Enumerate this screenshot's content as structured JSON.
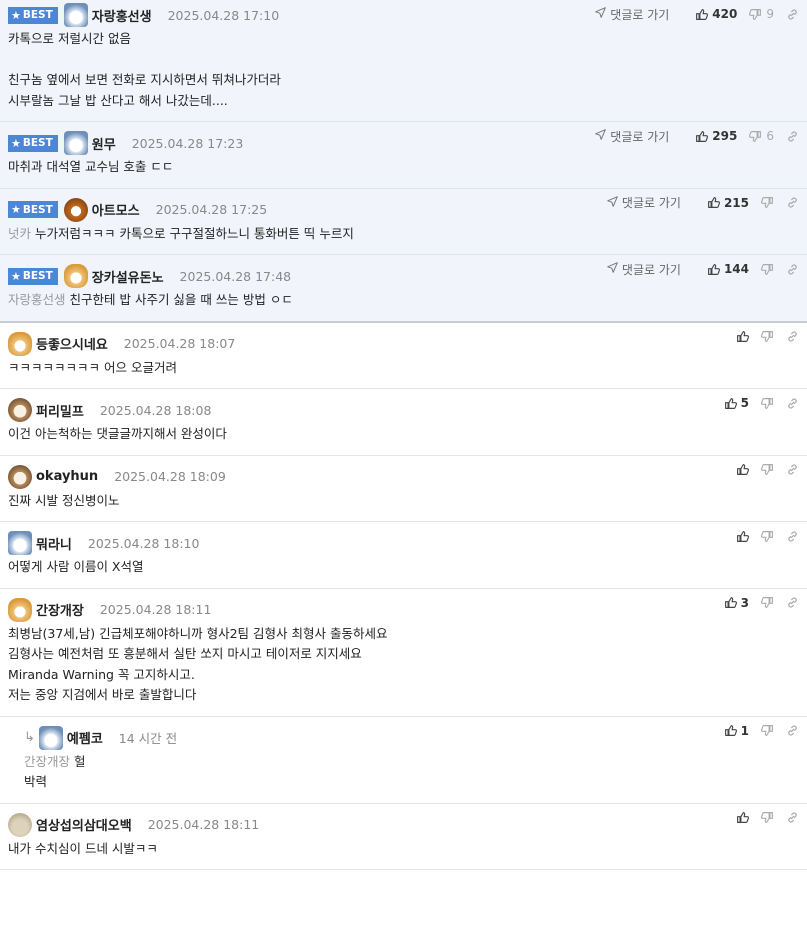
{
  "best_label": "BEST",
  "goto_label": "댓글로 가기",
  "comments": [
    {
      "best": true,
      "avatar": "av-blue",
      "nick": "자랑홍선생",
      "date": "2025.04.28 17:10",
      "up": "420",
      "down": "9",
      "goto": true,
      "lines": [
        "카톡으로 저럴시간 없음",
        "",
        "친구놈 옆에서 보면 전화로 지시하면서 뛰쳐나가더라",
        "시부랄놈 그날 밥 산다고 해서 나갔는데...."
      ]
    },
    {
      "best": true,
      "avatar": "av-blue",
      "nick": "원무",
      "date": "2025.04.28 17:23",
      "up": "295",
      "down": "6",
      "goto": true,
      "lines": [
        "마취과 대석열 교수님 호출 ㄷㄷ"
      ]
    },
    {
      "best": true,
      "avatar": "av-bear",
      "nick": "아트모스",
      "date": "2025.04.28 17:25",
      "up": "215",
      "down": "",
      "goto": true,
      "mention": "넛카",
      "lines": [
        "누가저럼ㅋㅋㅋ 카톡으로 구구절절하느니 통화버튼 띡 누르지"
      ]
    },
    {
      "best": true,
      "avatar": "av-dog",
      "nick": "장카설유돈노",
      "date": "2025.04.28 17:48",
      "up": "144",
      "down": "",
      "goto": true,
      "mention": "자랑홍선생",
      "lines": [
        "친구한테 밥 사주기 싫을 때 쓰는 방법 ㅇㄷ"
      ]
    },
    {
      "best": false,
      "avatar": "av-dog",
      "nick": "등좋으시네요",
      "date": "2025.04.28 18:07",
      "up": "",
      "down": "",
      "goto": false,
      "lines": [
        "ㅋㅋㅋㅋㅋㅋㅋㅋ 어으 오글거려"
      ]
    },
    {
      "best": false,
      "avatar": "av-puppy",
      "nick": "퍼리밀프",
      "date": "2025.04.28 18:08",
      "up": "5",
      "down": "",
      "goto": false,
      "lines": [
        "이건 아는척하는 댓글글까지해서 완성이다"
      ]
    },
    {
      "best": false,
      "avatar": "av-puppy",
      "nick": "okayhun",
      "date": "2025.04.28 18:09",
      "up": "",
      "down": "",
      "goto": false,
      "lines": [
        "진짜 시발 정신병이노"
      ]
    },
    {
      "best": false,
      "avatar": "av-blue",
      "nick": "뭐라니",
      "date": "2025.04.28 18:10",
      "up": "",
      "down": "",
      "goto": false,
      "lines": [
        "어떻게 사람 이름이 X석열"
      ]
    },
    {
      "best": false,
      "avatar": "av-dog",
      "nick": "간장개장",
      "date": "2025.04.28 18:11",
      "up": "3",
      "down": "",
      "goto": false,
      "lines": [
        "최병남(37세,남) 긴급체포해야하니까 형사2팀 김형사 최형사 출동하세요",
        "김형사는 예전처럼 또 흥분해서 실탄 쏘지 마시고 테이저로 지지세요",
        "Miranda Warning 꼭 고지하시고.",
        "저는 중앙 지검에서 바로 출발합니다"
      ]
    },
    {
      "best": false,
      "reply": true,
      "avatar": "av-blue",
      "nick": "예펨코",
      "date": "14 시간 전",
      "up": "1",
      "down": "",
      "goto": false,
      "mention": "간장개장",
      "lines": [
        "헐",
        "박력"
      ]
    },
    {
      "best": false,
      "avatar": "av-stone",
      "nick": "염상섭의삼대오백",
      "date": "2025.04.28 18:11",
      "up": "",
      "down": "",
      "goto": false,
      "lines": [
        "내가 수치심이 드네 시발ㅋㅋ"
      ]
    }
  ]
}
